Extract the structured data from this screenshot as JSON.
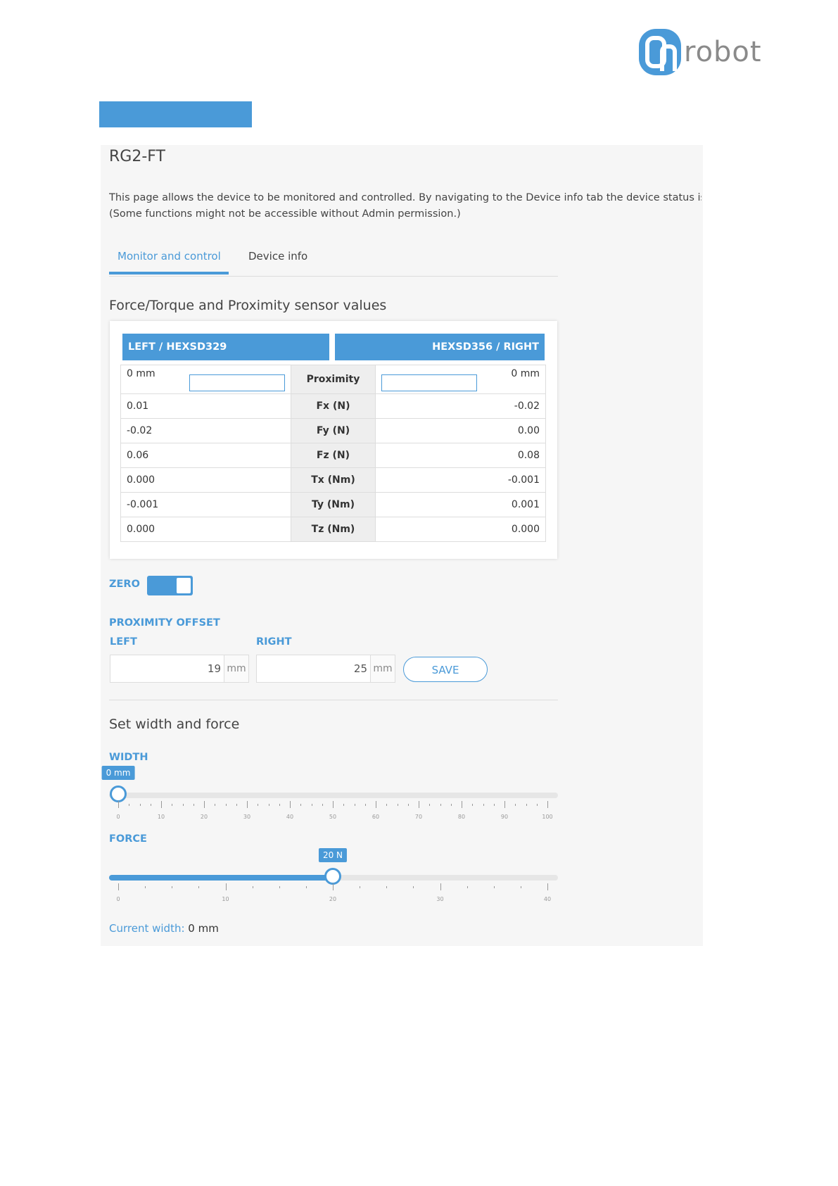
{
  "logo": {
    "text": "robot"
  },
  "page": {
    "title": "RG2-FT",
    "description_line1": "This page allows the device to be monitored and controlled. By navigating to the Device info tab the device status is",
    "description_line2": "(Some functions might not be accessible without Admin permission.)"
  },
  "tabs": [
    {
      "label": "Monitor and control",
      "active": true
    },
    {
      "label": "Device info",
      "active": false
    }
  ],
  "sensor": {
    "section_title": "Force/Torque and Proximity sensor values",
    "left_header": "LEFT / HEXSD329",
    "right_header": "HEXSD356 / RIGHT",
    "proximity": {
      "label": "Proximity",
      "left": "0 mm",
      "right": "0 mm"
    },
    "rows": [
      {
        "label": "Fx (N)",
        "left": "0.01",
        "right": "-0.02"
      },
      {
        "label": "Fy (N)",
        "left": "-0.02",
        "right": "0.00"
      },
      {
        "label": "Fz (N)",
        "left": "0.06",
        "right": "0.08"
      },
      {
        "label": "Tx (Nm)",
        "left": "0.000",
        "right": "-0.001"
      },
      {
        "label": "Ty (Nm)",
        "left": "-0.001",
        "right": "0.001"
      },
      {
        "label": "Tz (Nm)",
        "left": "0.000",
        "right": "0.000"
      }
    ]
  },
  "zero": {
    "label": "ZERO",
    "on": true
  },
  "proximity_offset": {
    "label": "PROXIMITY OFFSET",
    "left_label": "LEFT",
    "right_label": "RIGHT",
    "left_value": "19",
    "right_value": "25",
    "unit": "mm",
    "save_label": "SAVE"
  },
  "width_force": {
    "section_title": "Set width and force",
    "width": {
      "label": "WIDTH",
      "bubble": "0 mm",
      "value": 0,
      "min": 0,
      "max": 100,
      "tick_labels": [
        "0",
        "10",
        "20",
        "30",
        "40",
        "50",
        "60",
        "70",
        "80",
        "90",
        "100"
      ]
    },
    "force": {
      "label": "FORCE",
      "bubble": "20 N",
      "value": 20,
      "min": 0,
      "max": 40,
      "tick_labels": [
        "0",
        "10",
        "20",
        "30",
        "40"
      ]
    },
    "current_width_label": "Current width:",
    "current_width_value": "0 mm"
  },
  "colors": {
    "accent": "#4a9ad8",
    "panel": "#f6f6f6"
  }
}
